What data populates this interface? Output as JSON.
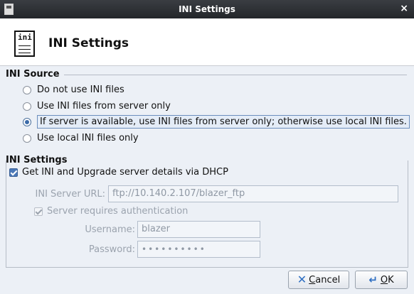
{
  "window": {
    "title": "INI Settings",
    "close_glyph": "×"
  },
  "header": {
    "icon_text": "ini",
    "title": "INI Settings"
  },
  "ini_source": {
    "title": "INI Source",
    "options": [
      {
        "label": "Do not use INI files",
        "selected": false
      },
      {
        "label": "Use INI files from server only",
        "selected": false
      },
      {
        "label": "If server is available, use INI files from server only; otherwise use local INI files.",
        "selected": true
      },
      {
        "label": "Use local INI files only",
        "selected": false
      }
    ]
  },
  "ini_settings": {
    "title": "INI Settings",
    "dhcp_label": "Get INI and Upgrade server details via DHCP",
    "server_url_label": "INI Server URL:",
    "server_url_value": "ftp://10.140.2.107/blazer_ftp",
    "auth_label": "Server requires authentication",
    "username_label": "Username:",
    "username_value": "blazer",
    "password_label": "Password:",
    "password_value": "••••••••••"
  },
  "buttons": {
    "cancel_underline": "C",
    "cancel_rest": "ancel",
    "ok_underline": "O",
    "ok_rest": "K"
  },
  "colors": {
    "accent": "#2f6fc2",
    "selection_bg": "#e4ecf7"
  }
}
